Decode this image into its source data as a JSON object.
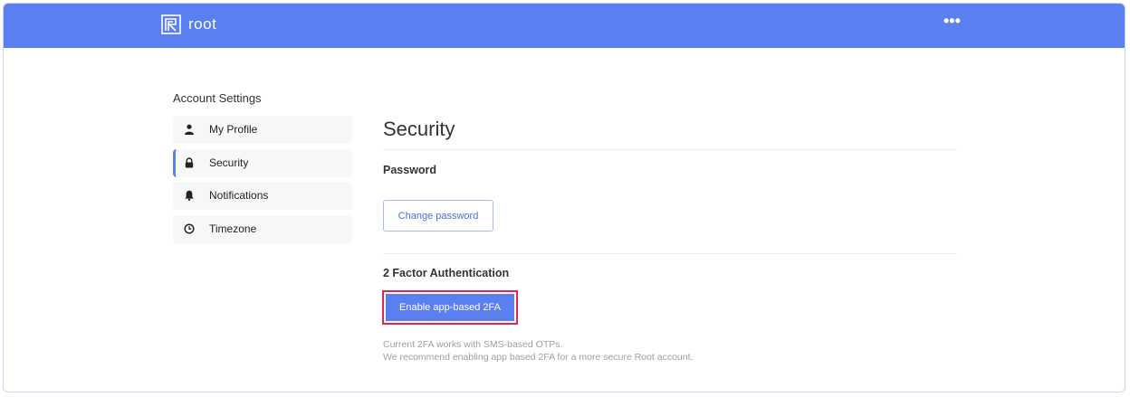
{
  "header": {
    "brand_name": "root",
    "more_label": "•••",
    "color": "#5a7ff0"
  },
  "sidebar": {
    "title": "Account Settings",
    "items": [
      {
        "label": "My Profile",
        "icon": "user-icon",
        "active": false
      },
      {
        "label": "Security",
        "icon": "lock-icon",
        "active": true
      },
      {
        "label": "Notifications",
        "icon": "bell-icon",
        "active": false
      },
      {
        "label": "Timezone",
        "icon": "clock-icon",
        "active": false
      }
    ]
  },
  "main": {
    "title": "Security",
    "password": {
      "heading": "Password",
      "button_label": "Change password"
    },
    "twofa": {
      "heading": "2 Factor Authentication",
      "button_label": "Enable app-based 2FA",
      "note_line1": "Current 2FA works with SMS-based OTPs.",
      "note_line2": "We recommend enabling app based 2FA for a more secure Root account."
    }
  },
  "colors": {
    "accent": "#5a7ff0",
    "highlight": "#e0245e"
  }
}
